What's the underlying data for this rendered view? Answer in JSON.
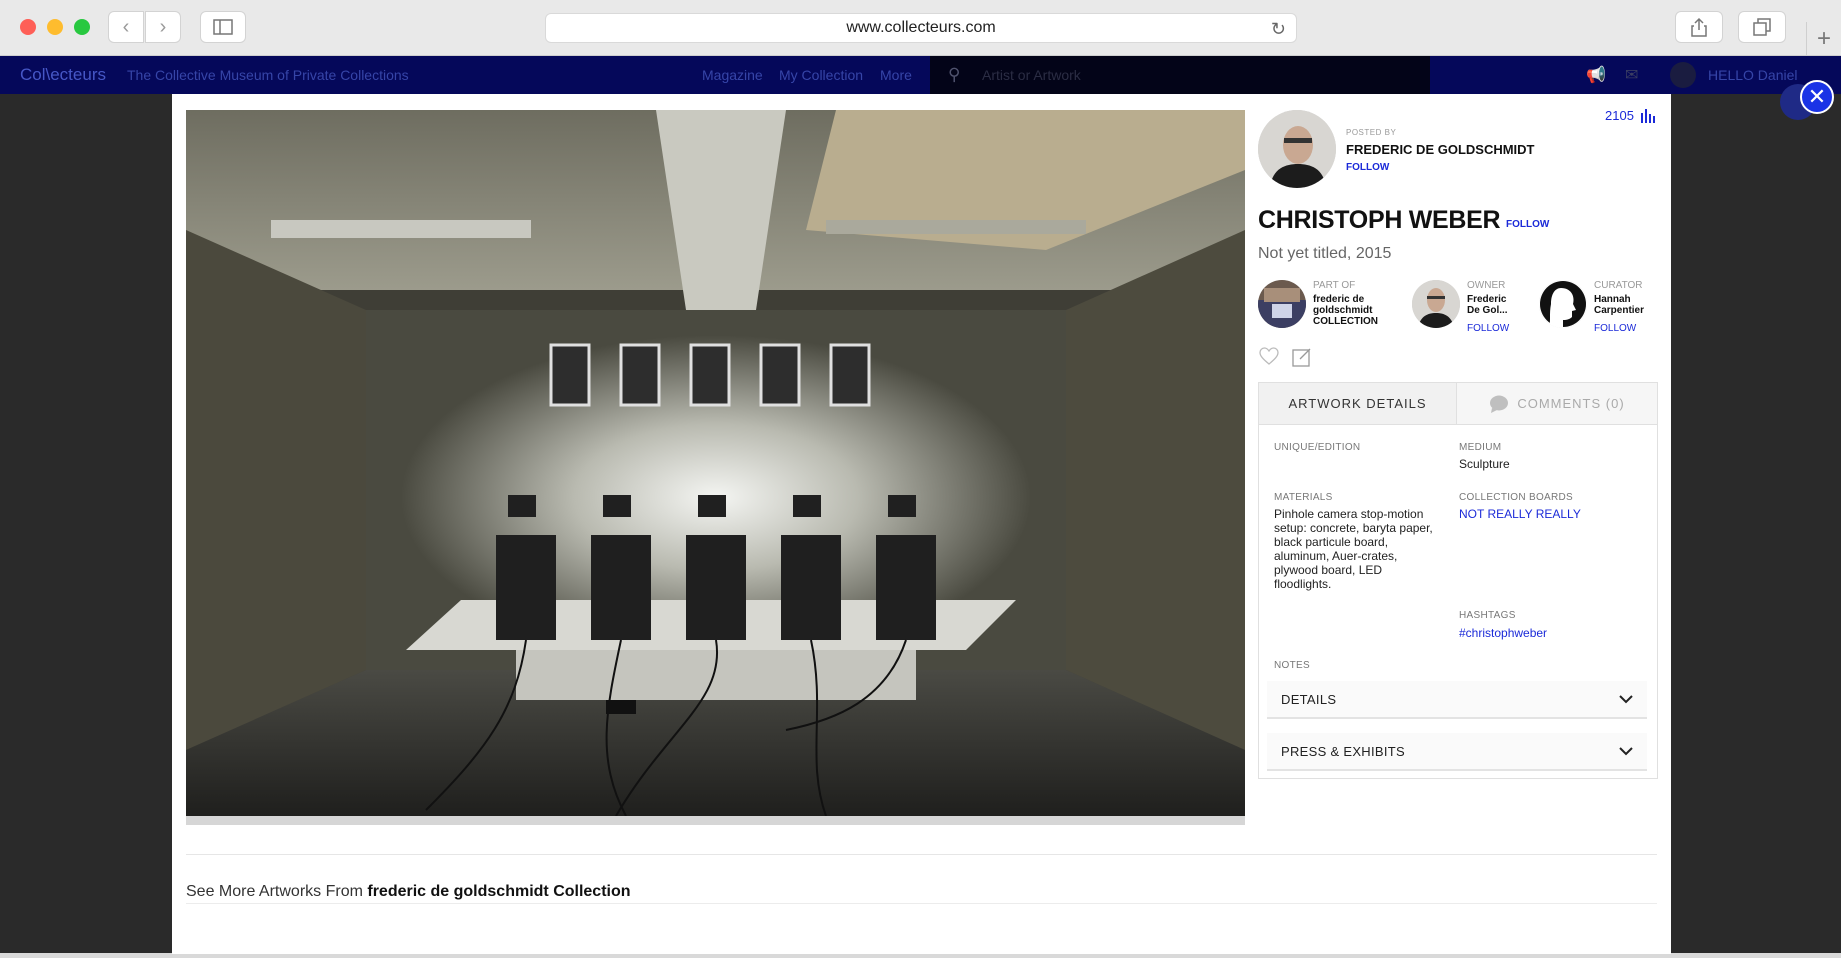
{
  "browser": {
    "url": "www.collecteurs.com"
  },
  "site_header": {
    "logo": "Col\\ecteurs",
    "tagline": "The Collective Museum of Private Collections",
    "nav": [
      "Magazine",
      "My Collection",
      "More"
    ],
    "search_placeholder": "Artist or Artwork",
    "greeting": "HELLO Daniel"
  },
  "post": {
    "view_count": "2105",
    "posted_by_label": "POSTED BY",
    "poster_name": "FREDERIC DE GOLDSCHMIDT",
    "poster_follow": "FOLLOW"
  },
  "artwork": {
    "artist": "CHRISTOPH WEBER",
    "artist_follow": "FOLLOW",
    "title": "Not yet titled, 2015"
  },
  "roles": [
    {
      "label": "PART OF",
      "name_line1": "frederic de",
      "name_line2": "goldschmidt",
      "name_line3": "COLLECTION"
    },
    {
      "label": "OWNER",
      "name_line1": "Frederic",
      "name_line2": "De Gol...",
      "follow": "FOLLOW"
    },
    {
      "label": "CURATOR",
      "name_line1": "Hannah",
      "name_line2": "Carpentier",
      "follow": "FOLLOW"
    }
  ],
  "tabs": {
    "details": "ARTWORK DETAILS",
    "comments": "COMMENTS (0)"
  },
  "details": {
    "unique_label": "UNIQUE/EDITION",
    "medium_label": "MEDIUM",
    "medium_value": "Sculpture",
    "materials_label": "MATERIALS",
    "materials_lines": [
      "Pinhole camera stop-motion",
      "setup: concrete, baryta paper,",
      "black particule board,",
      "aluminum, Auer-crates,",
      "plywood board, LED",
      "floodlights."
    ],
    "boards_label": "COLLECTION BOARDS",
    "boards_value": "NOT REALLY REALLY",
    "hashtags_label": "HASHTAGS",
    "hashtags_value": "#christophweber",
    "notes_label": "NOTES"
  },
  "accordions": {
    "details": "DETAILS",
    "press": "PRESS & EXHIBITS"
  },
  "see_more": {
    "prefix": "See More Artworks From ",
    "collection": "frederic de goldschmidt Collection"
  }
}
